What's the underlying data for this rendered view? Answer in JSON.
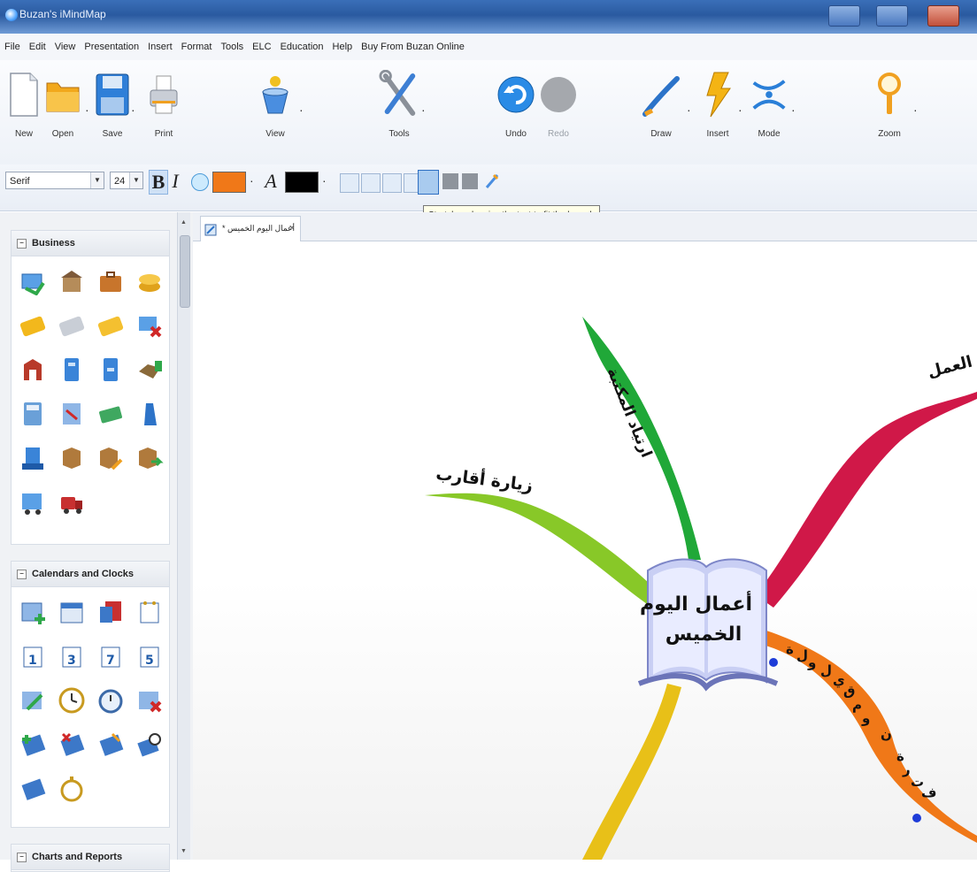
{
  "window": {
    "title": "Buzan's iMindMap"
  },
  "menu": [
    "File",
    "Edit",
    "View",
    "Presentation",
    "Insert",
    "Format",
    "Tools",
    "ELC",
    "Education",
    "Help",
    "Buy From Buzan Online"
  ],
  "toolbar": {
    "new": "New",
    "open": "Open",
    "save": "Save",
    "print": "Print",
    "view": "View",
    "tools": "Tools",
    "undo": "Undo",
    "redo": "Redo",
    "draw": "Draw",
    "insert": "Insert",
    "mode": "Mode",
    "zoom": "Zoom"
  },
  "format": {
    "font": "Serif",
    "size": "24",
    "bold": "B",
    "italic": "I",
    "text_color_glyph": "A",
    "branch_color": "#f07818",
    "text_color": "#000000"
  },
  "tooltip": "Stretch and resize the text to fit the branch",
  "sidebar": {
    "panels": [
      {
        "title": "Business"
      },
      {
        "title": "Calendars and Clocks"
      },
      {
        "title": "Charts and Reports"
      }
    ]
  },
  "document": {
    "tab_title": "أعمال اليوم الخميس *",
    "close": "×"
  },
  "mindmap": {
    "central_line1": "أعمال اليوم",
    "central_line2": "الخميس",
    "branches": [
      {
        "label": "العمل",
        "color": "#d01848"
      },
      {
        "label": "ارتياد المكتبة",
        "color": "#20a838"
      },
      {
        "label": "زيارة أقارب",
        "color": "#88c828"
      },
      {
        "label": "فترة نوم قيلولة",
        "color": "#f07818"
      },
      {
        "label": "",
        "color": "#e8c018"
      }
    ],
    "orange_letters": [
      "ف",
      "ت",
      "ر",
      "ة",
      "ن",
      "و",
      "م",
      "ق",
      "ي",
      "ل",
      "و",
      "ل",
      "ة"
    ]
  }
}
